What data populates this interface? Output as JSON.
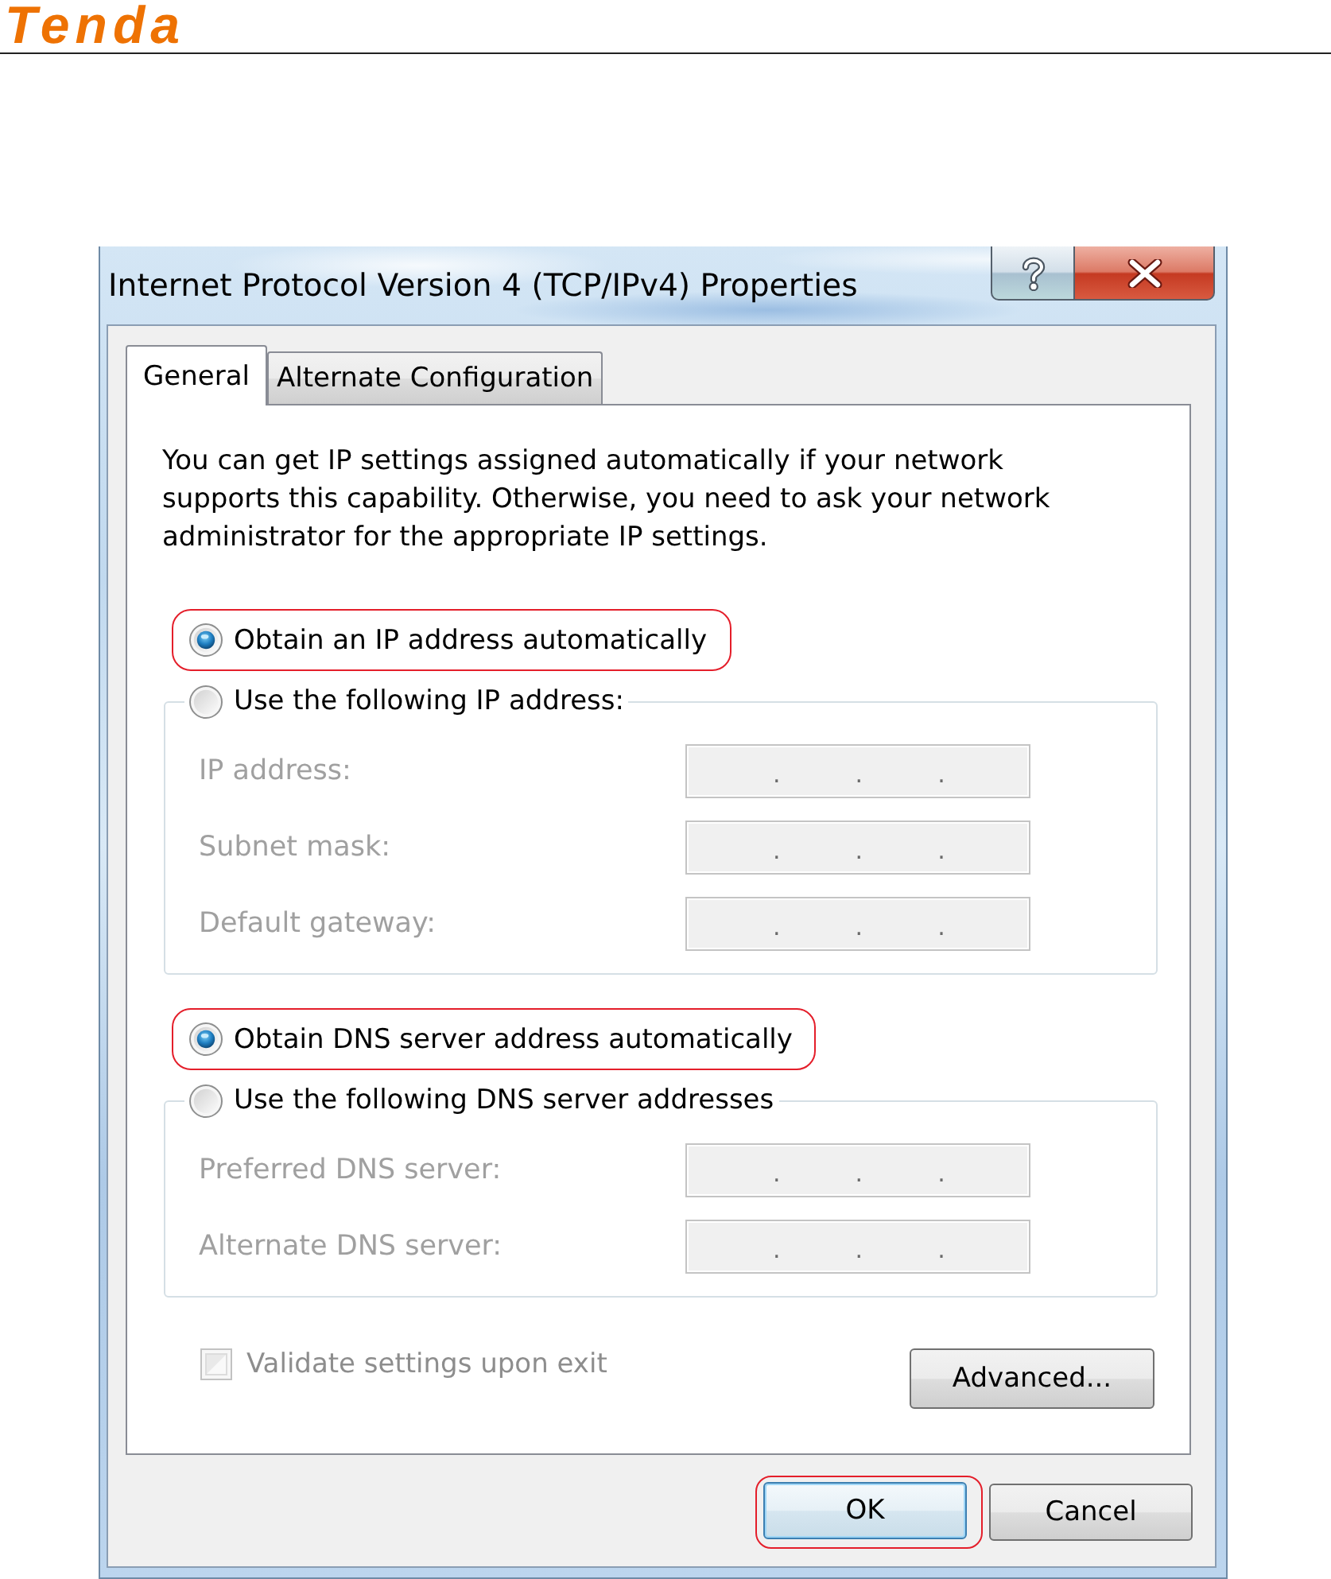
{
  "header": {
    "logo": "Tenda"
  },
  "dialog": {
    "title": "Internet Protocol Version 4 (TCP/IPv4) Properties",
    "tabs": [
      {
        "label": "General",
        "selected": true
      },
      {
        "label": "Alternate Configuration",
        "selected": false
      }
    ],
    "description": "You can get IP settings assigned automatically if your network supports this capability. Otherwise, you need to ask your network administrator for the appropriate IP settings.",
    "sections": [
      {
        "auto_option": {
          "label": "Obtain an IP address automatically",
          "selected": true,
          "highlighted": true
        },
        "manual_option": {
          "label": "Use the following IP address:",
          "selected": false,
          "highlighted": false
        },
        "fields": [
          {
            "label": "IP address:",
            "disabled": true,
            "separators": [
              ".",
              ".",
              "."
            ]
          },
          {
            "label": "Subnet mask:",
            "disabled": true,
            "separators": [
              ".",
              ".",
              "."
            ]
          },
          {
            "label": "Default gateway:",
            "disabled": true,
            "separators": [
              ".",
              ".",
              "."
            ]
          }
        ]
      },
      {
        "auto_option": {
          "label": "Obtain DNS server address automatically",
          "selected": true,
          "highlighted": true
        },
        "manual_option": {
          "label": "Use the following DNS server addresses",
          "selected": false,
          "highlighted": false
        },
        "fields": [
          {
            "label": "Preferred DNS server:",
            "disabled": true,
            "separators": [
              ".",
              ".",
              "."
            ]
          },
          {
            "label": "Alternate DNS server:",
            "disabled": true,
            "separators": [
              ".",
              ".",
              "."
            ]
          }
        ]
      }
    ],
    "validate": {
      "label": "Validate settings upon exit",
      "checked": false,
      "disabled": true
    },
    "advanced_button": {
      "label": "Advanced..."
    },
    "buttons": [
      {
        "label": "OK",
        "default": true,
        "highlighted": true
      },
      {
        "label": "Cancel",
        "default": false,
        "highlighted": false
      }
    ]
  }
}
